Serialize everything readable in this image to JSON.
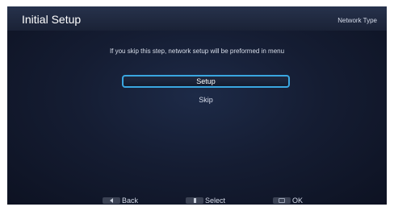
{
  "header": {
    "title": "Initial Setup",
    "section": "Network Type"
  },
  "message": "If you skip this step, network setup will be preformed in menu",
  "options": [
    {
      "label": "Setup",
      "selected": true
    },
    {
      "label": "Skip",
      "selected": false
    }
  ],
  "footer": {
    "hints": [
      {
        "label": "Back",
        "key_icon": "left-arrow-key-icon"
      },
      {
        "label": "Select",
        "key_icon": "up-down-key-icon"
      },
      {
        "label": "OK",
        "key_icon": "ok-key-icon"
      }
    ]
  },
  "colors": {
    "background": "#151d33",
    "highlight_border": "#3aa6e0",
    "text": "#ffffff"
  }
}
